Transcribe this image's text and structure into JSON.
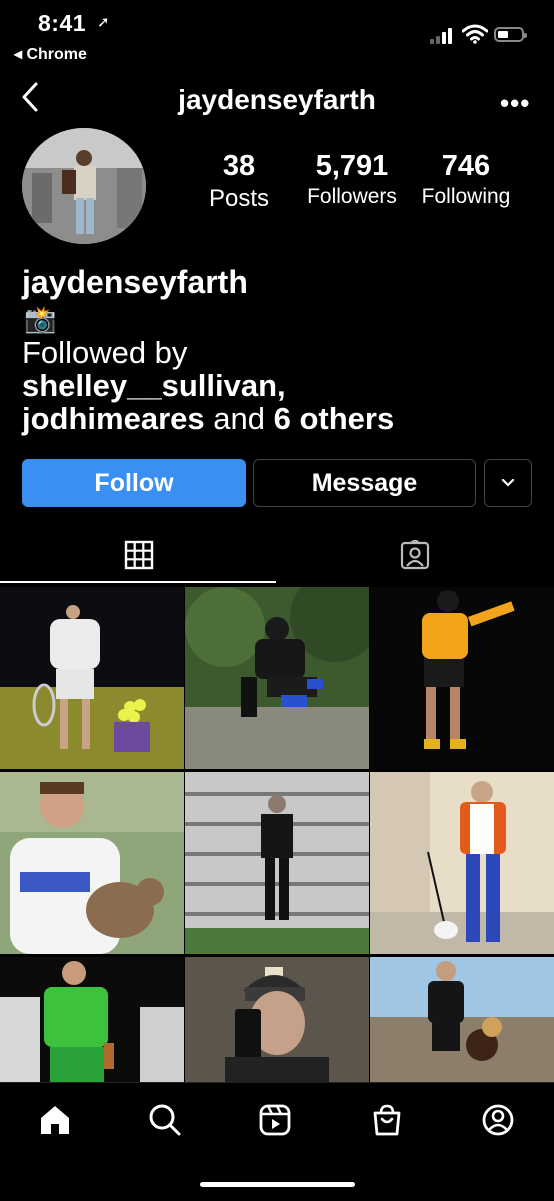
{
  "status_bar": {
    "time": "8:41",
    "location_icon": "location-arrow-icon",
    "back_app": "◂ Chrome"
  },
  "header": {
    "username": "jaydenseyfarth",
    "more": "•••"
  },
  "profile": {
    "stats": [
      {
        "value": "38",
        "label": "Posts"
      },
      {
        "value": "5,791",
        "label": "Followers"
      },
      {
        "value": "746",
        "label": "Following"
      }
    ],
    "display_name": "jaydenseyfarth",
    "bio_emoji": "📸",
    "followed_by_prefix": "Followed by",
    "followed_user_1": "shelley__sullivan,",
    "followed_user_2": "jodhimeares",
    "followed_and": "and",
    "followed_others": "6 others"
  },
  "actions": {
    "follow": "Follow",
    "message": "Message",
    "dropdown_icon": "chevron-down-icon"
  },
  "tabs": [
    {
      "icon": "grid-icon",
      "active": true
    },
    {
      "icon": "tagged-icon",
      "active": false
    }
  ],
  "posts": [
    {
      "alt": "post-1"
    },
    {
      "alt": "post-2"
    },
    {
      "alt": "post-3"
    },
    {
      "alt": "post-4"
    },
    {
      "alt": "post-5"
    },
    {
      "alt": "post-6"
    },
    {
      "alt": "post-7"
    },
    {
      "alt": "post-8"
    },
    {
      "alt": "post-9"
    }
  ],
  "bottom_nav": [
    "home-icon",
    "search-icon",
    "reels-icon",
    "shop-icon",
    "profile-icon"
  ],
  "colors": {
    "accent": "#3a8ff0",
    "background": "#000000"
  }
}
